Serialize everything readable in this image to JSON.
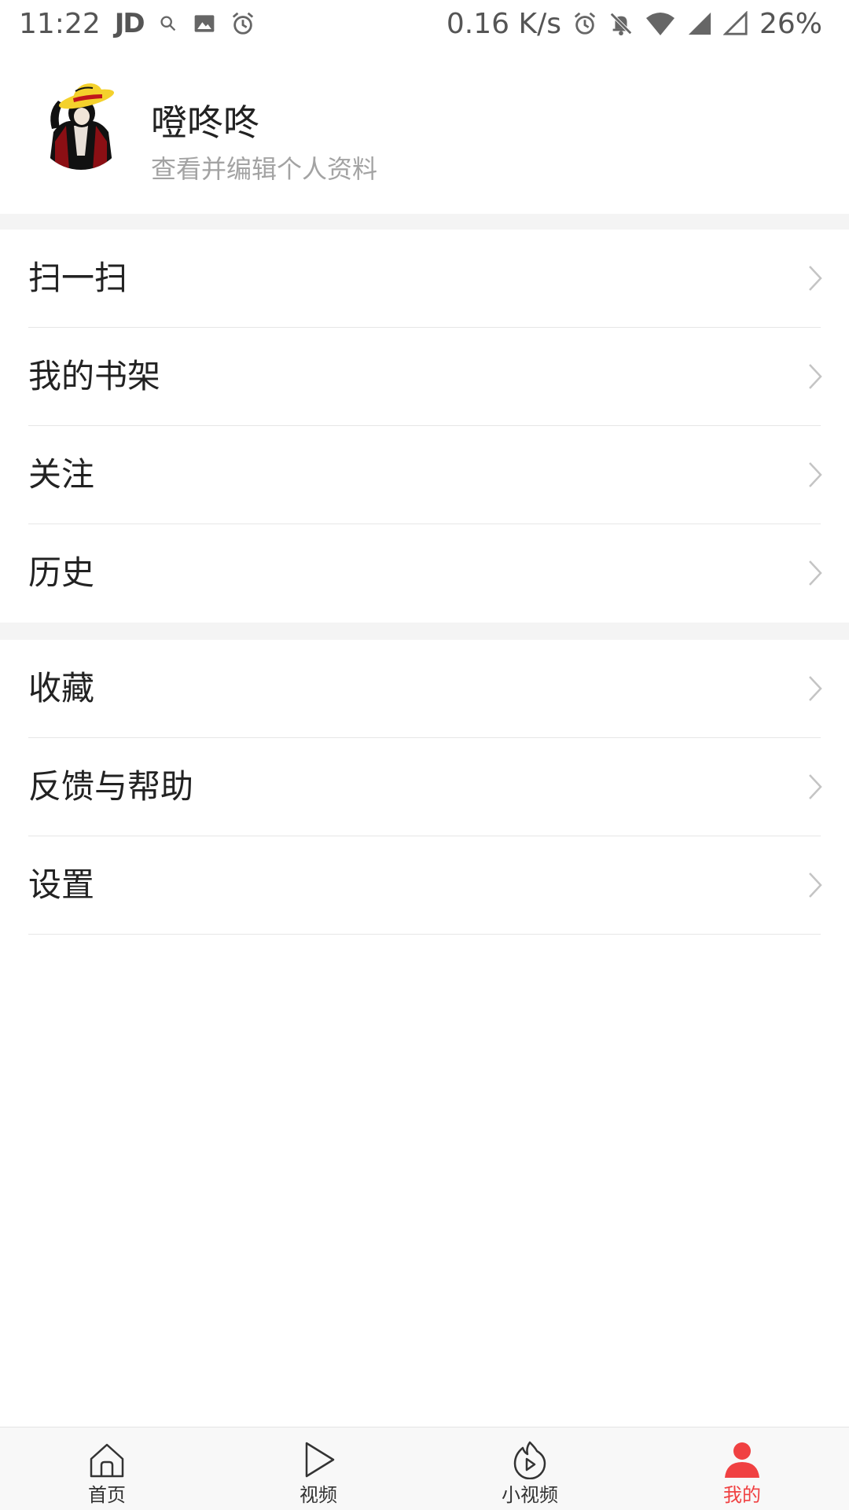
{
  "status_bar": {
    "time": "11:22",
    "app_badge": "JD",
    "net_speed": "0.16 K/s",
    "battery": "26%",
    "left_icons": [
      "search-icon",
      "image-icon",
      "alarm-icon"
    ],
    "right_icons": [
      "alarm-icon",
      "bell-off-icon",
      "wifi-icon",
      "signal-icon",
      "signal-empty-icon"
    ]
  },
  "profile": {
    "name": "噔咚咚",
    "subtitle": "查看并编辑个人资料"
  },
  "menu_groups": [
    {
      "items": [
        {
          "label": "扫一扫"
        },
        {
          "label": "我的书架"
        },
        {
          "label": "关注"
        },
        {
          "label": "历史"
        }
      ]
    },
    {
      "items": [
        {
          "label": "收藏"
        },
        {
          "label": "反馈与帮助"
        },
        {
          "label": "设置"
        }
      ]
    }
  ],
  "tabbar": {
    "tabs": [
      {
        "label": "首页",
        "icon": "home-icon",
        "active": false
      },
      {
        "label": "视频",
        "icon": "play-icon",
        "active": false
      },
      {
        "label": "小视频",
        "icon": "short-video-icon",
        "active": false
      },
      {
        "label": "我的",
        "icon": "person-icon",
        "active": true
      }
    ]
  },
  "colors": {
    "accent": "#f04142",
    "text_primary": "#222222",
    "text_secondary": "#a3a3a3",
    "divider": "#e6e6e6",
    "section_gap": "#f4f4f4"
  }
}
